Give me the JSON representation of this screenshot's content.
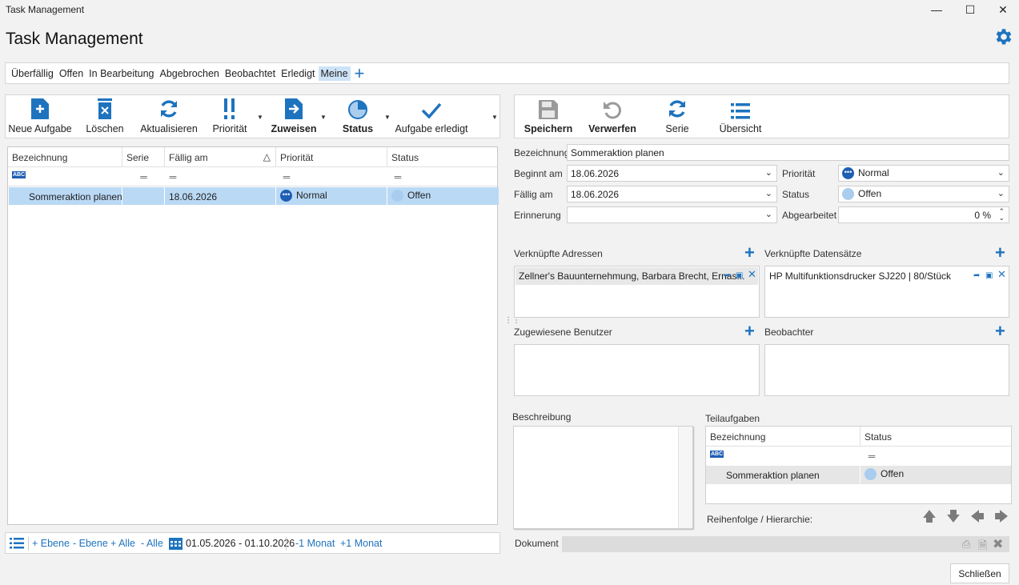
{
  "window": {
    "title": "Task Management"
  },
  "app": {
    "title": "Task Management"
  },
  "tabs": [
    {
      "label": "Überfällig"
    },
    {
      "label": "Offen"
    },
    {
      "label": "In Bearbeitung"
    },
    {
      "label": "Abgebrochen"
    },
    {
      "label": "Beobachtet"
    },
    {
      "label": "Erledigt"
    },
    {
      "label": "Meine"
    }
  ],
  "left_toolbar": {
    "new": "Neue Aufgabe",
    "delete": "Löschen",
    "refresh": "Aktualisieren",
    "priority": "Priorität",
    "assign": "Zuweisen",
    "status": "Status",
    "done": "Aufgabe erledigt"
  },
  "right_toolbar": {
    "save": "Speichern",
    "discard": "Verwerfen",
    "series": "Serie",
    "overview": "Übersicht"
  },
  "grid": {
    "columns": [
      "Bezeichnung",
      "Serie",
      "Fällig am",
      "Priorität",
      "Status"
    ],
    "rows": [
      {
        "name": "Sommeraktion planen",
        "series": "",
        "due": "18.06.2026",
        "priority": "Normal",
        "status": "Offen"
      }
    ]
  },
  "bottom_bar": {
    "plus_level": "+ Ebene",
    "minus_level": "- Ebene",
    "plus_all": "+ Alle",
    "minus_all": "- Alle",
    "date_range": "01.05.2026 - 01.10.2026",
    "minus_month": "-1 Monat",
    "plus_month": "+1 Monat"
  },
  "detail": {
    "name_label": "Bezeichnung",
    "name_value": "Sommeraktion planen",
    "start_label": "Beginnt am",
    "start_value": "18.06.2026",
    "due_label": "Fällig am",
    "due_value": "18.06.2026",
    "reminder_label": "Erinnerung",
    "reminder_value": "",
    "priority_label": "Priorität",
    "priority_value": "Normal",
    "status_label": "Status",
    "status_value": "Offen",
    "progress_label": "Abgearbeitet",
    "progress_value": "0 %",
    "addresses_label": "Verknüpfte Adressen",
    "address_item": "Zellner's Bauunternehmung, Barbara Brecht, Ernas...",
    "records_label": "Verknüpfte Datensätze",
    "record_item": "HP Multifunktionsdrucker SJ220 | 80/Stück",
    "users_label": "Zugewiesene Benutzer",
    "observers_label": "Beobachter",
    "description_label": "Beschreibung",
    "subtasks_label": "Teilaufgaben",
    "subtask_columns": [
      "Bezeichnung",
      "Status"
    ],
    "subtasks": [
      {
        "name": "Sommeraktion planen",
        "status": "Offen"
      }
    ],
    "order_label": "Reihenfolge / Hierarchie:",
    "document_label": "Dokument"
  },
  "close_button": "Schließen",
  "colors": {
    "accent": "#1e73be",
    "selection": "#bad9f5",
    "priority_dot": "#1e5eb3",
    "status_dot": "#a9ccef"
  }
}
